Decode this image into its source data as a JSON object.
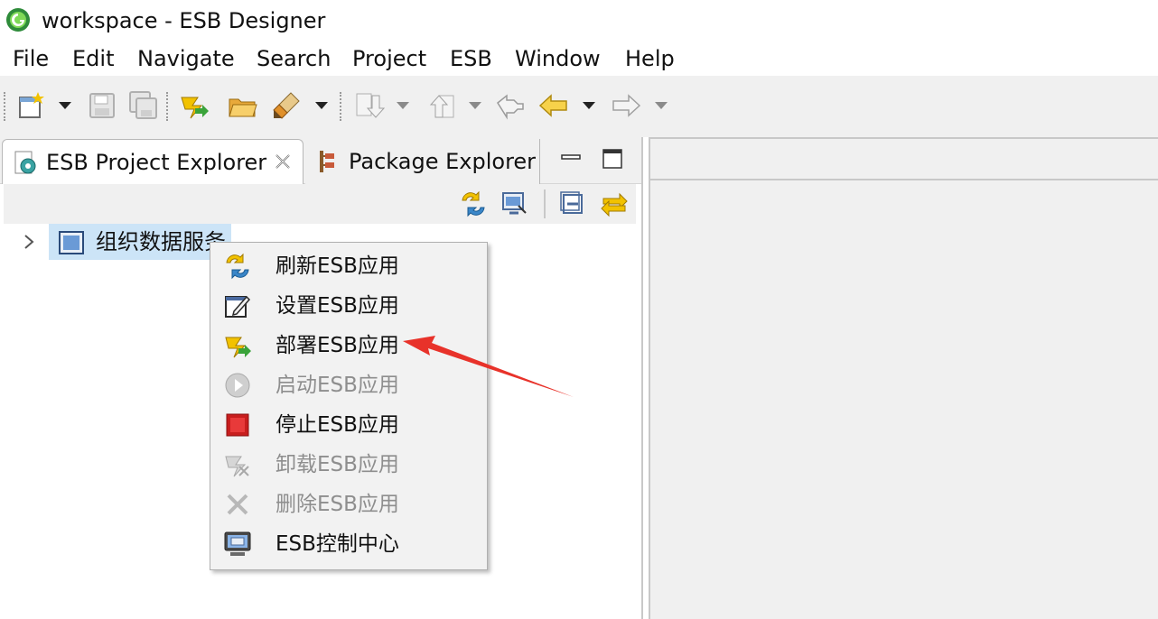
{
  "window": {
    "title": "workspace - ESB Designer"
  },
  "menu": {
    "items": [
      "File",
      "Edit",
      "Navigate",
      "Search",
      "Project",
      "ESB",
      "Window",
      "Help"
    ]
  },
  "toolbar": {
    "buttons": [
      "new-icon",
      "save-icon",
      "save-all-icon",
      "deploy-icon",
      "open-folder-icon",
      "brush-icon",
      "download-icon",
      "upload-icon",
      "back-history-icon",
      "back-arrow-icon",
      "forward-arrow-icon"
    ]
  },
  "explorer": {
    "tabs": [
      {
        "label": "ESB Project Explorer",
        "active": true
      },
      {
        "label": "Package Explorer",
        "active": false
      }
    ],
    "tree": [
      {
        "label": "组织数据服务"
      }
    ]
  },
  "context_menu": {
    "items": [
      {
        "label": "刷新ESB应用",
        "icon": "refresh-icon",
        "enabled": true
      },
      {
        "label": "设置ESB应用",
        "icon": "settings-edit-icon",
        "enabled": true
      },
      {
        "label": "部署ESB应用",
        "icon": "deploy-icon",
        "enabled": true
      },
      {
        "label": "启动ESB应用",
        "icon": "start-icon",
        "enabled": false
      },
      {
        "label": "停止ESB应用",
        "icon": "stop-icon",
        "enabled": true
      },
      {
        "label": "卸载ESB应用",
        "icon": "uninstall-icon",
        "enabled": false
      },
      {
        "label": "删除ESB应用",
        "icon": "delete-icon",
        "enabled": false
      },
      {
        "label": "ESB控制中心",
        "icon": "console-icon",
        "enabled": true
      }
    ]
  },
  "colors": {
    "selection": "#cce4f7",
    "toolbar_bg": "#f0f0f0",
    "annotation_arrow": "#e8322a"
  }
}
